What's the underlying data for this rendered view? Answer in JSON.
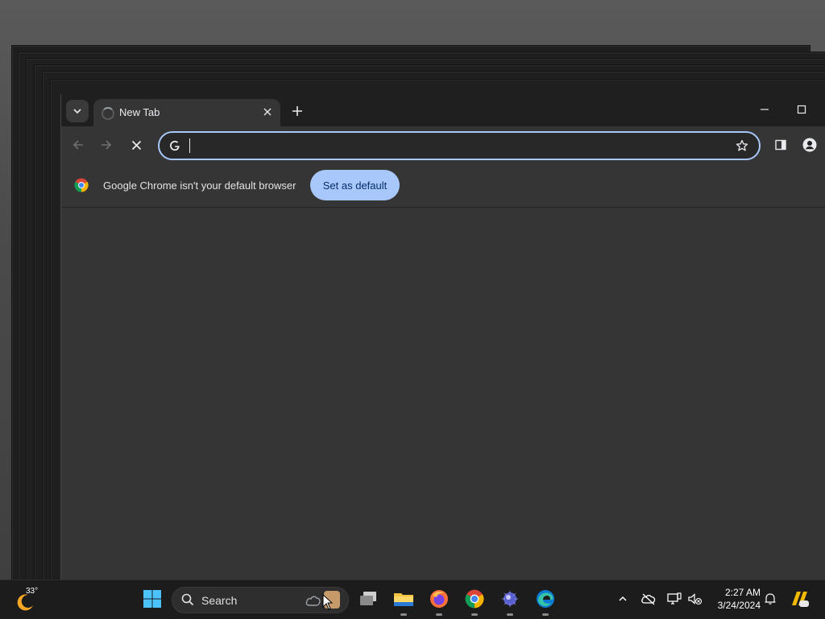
{
  "browser": {
    "tab": {
      "title": "New Tab"
    },
    "omnibox": {
      "value": "",
      "placeholder": ""
    },
    "infobar": {
      "message": "Google Chrome isn't your default browser",
      "button_label": "Set as default"
    }
  },
  "taskbar": {
    "weather": {
      "temperature": "33°"
    },
    "search": {
      "label": "Search"
    },
    "pinned_apps": [
      "start-icon",
      "task-view-icon",
      "file-explorer-icon",
      "firefox-icon",
      "chrome-icon",
      "app-icon",
      "edge-icon"
    ],
    "clock": {
      "time": "2:27 AM",
      "date": "3/24/2024"
    }
  },
  "colors": {
    "accent": "#a8c7fa",
    "window_bg": "#353535",
    "titlebar_bg": "#1f1f1f",
    "taskbar_bg": "#1c1c1c"
  }
}
